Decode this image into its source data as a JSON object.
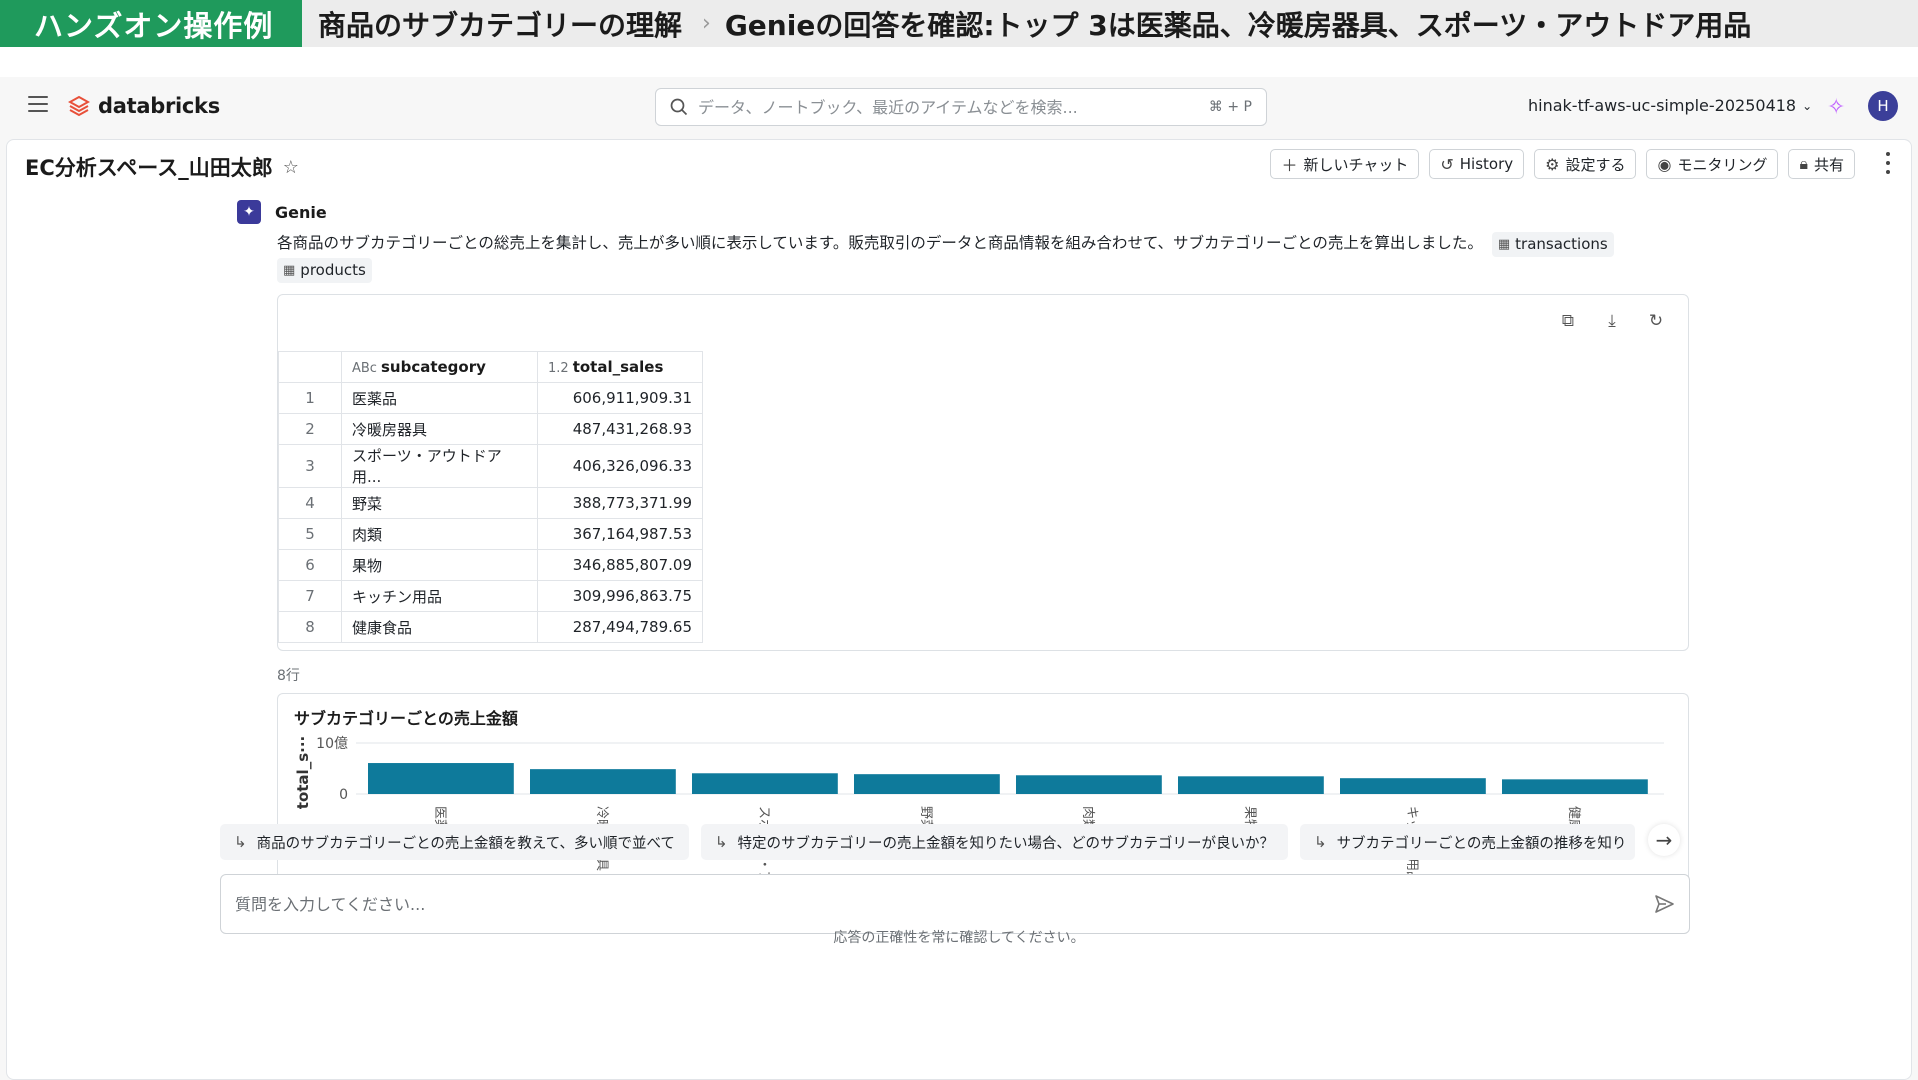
{
  "banner": {
    "tag": "ハンズオン操作例",
    "title": "商品のサブカテゴリーの理解",
    "separator": "›",
    "subtitle": "Genieの回答を確認:トップ 3は医薬品、冷暖房器具、スポーツ・アウトドア用品"
  },
  "app": {
    "logo_text": "databricks",
    "search": {
      "placeholder": "データ、ノートブック、最近のアイテムなどを検索...",
      "shortcut": "⌘ + P"
    },
    "workspace": "hinak-tf-aws-uc-simple-20250418",
    "avatar_initial": "H"
  },
  "space": {
    "title": "EC分析スペース_山田太郎",
    "toolbar": {
      "new_chat": "新しいチャット",
      "history": "History",
      "settings": "設定する",
      "monitoring": "モニタリング",
      "share": "共有"
    }
  },
  "genie": {
    "name": "Genie",
    "answer_text": "各商品のサブカテゴリーごとの総売上を集計し、売上が多い順に表示しています。販売取引のデータと商品情報を組み合わせて、サブカテゴリーごとの売上を算出しました。",
    "tables": [
      "transactions",
      "products"
    ]
  },
  "result": {
    "columns": [
      {
        "type_label": "ABc",
        "name": "subcategory"
      },
      {
        "type_label": "1.2",
        "name": "total_sales"
      }
    ],
    "rows": [
      {
        "idx": "1",
        "subcategory": "医薬品",
        "total_sales": "606,911,909.31"
      },
      {
        "idx": "2",
        "subcategory": "冷暖房器具",
        "total_sales": "487,431,268.93"
      },
      {
        "idx": "3",
        "subcategory": "スポーツ・アウトドア用...",
        "total_sales": "406,326,096.33"
      },
      {
        "idx": "4",
        "subcategory": "野菜",
        "total_sales": "388,773,371.99"
      },
      {
        "idx": "5",
        "subcategory": "肉類",
        "total_sales": "367,164,987.53"
      },
      {
        "idx": "6",
        "subcategory": "果物",
        "total_sales": "346,885,807.09"
      },
      {
        "idx": "7",
        "subcategory": "キッチン用品",
        "total_sales": "309,996,863.75"
      },
      {
        "idx": "8",
        "subcategory": "健康食品",
        "total_sales": "287,494,789.65"
      }
    ],
    "row_count": "8行"
  },
  "chart_data": {
    "type": "bar",
    "title": "サブカテゴリーごとの売上金額",
    "ylabel": "total_s···",
    "xlabel": "",
    "categories": [
      "医薬品",
      "冷暖房器具",
      "スポーツ・ア…",
      "野菜",
      "肉類",
      "果物",
      "キッチン用品",
      "健康食品"
    ],
    "values": [
      606911909.31,
      487431268.93,
      406326096.33,
      388773371.99,
      367164987.53,
      346885807.09,
      309996863.75,
      287494789.65
    ],
    "ylim": [
      0,
      1000000000
    ],
    "yticks": [
      {
        "value": 0,
        "label": "0"
      },
      {
        "value": 1000000000,
        "label": "10億"
      }
    ],
    "color": "#0e7a9b",
    "grid": true
  },
  "suggestions": [
    "商品のサブカテゴリーごとの売上金額を教えて、多い順で並べて",
    "特定のサブカテゴリーの売上金額を知りたい場合、どのサブカテゴリーが良いか？",
    "サブカテゴリーごとの売上金額の推移を知り"
  ],
  "composer": {
    "placeholder": "質問を入力してください..."
  },
  "disclaimer": "応答の正確性を常に確認してください。"
}
